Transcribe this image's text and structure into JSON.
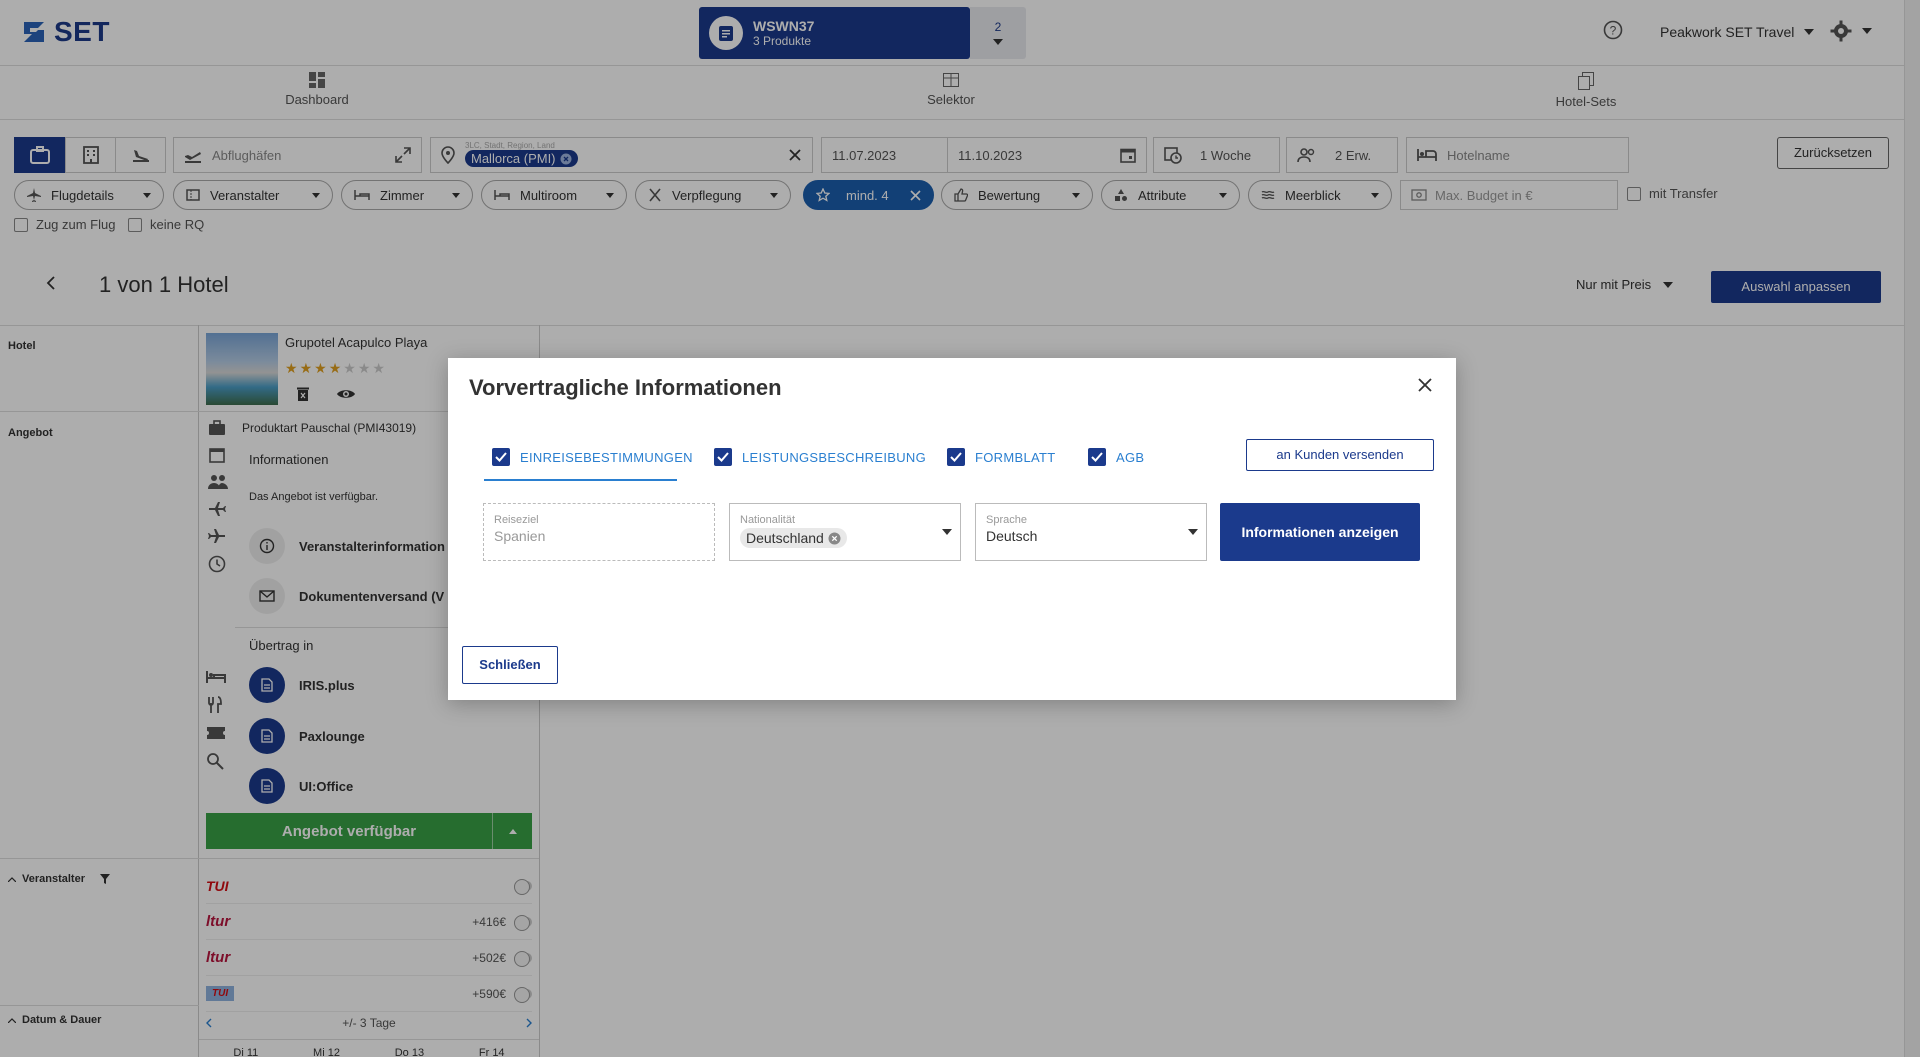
{
  "header": {
    "logo": "SET",
    "cart_code": "WSWN37",
    "cart_sub": "3 Produkte",
    "cart_count": "2",
    "agency": "Peakwork SET Travel"
  },
  "nav": {
    "tabs": [
      {
        "label": "Dashboard",
        "icon": "dashboard-icon"
      },
      {
        "label": "Selektor",
        "icon": "table-icon"
      },
      {
        "label": "Hotel-Sets",
        "icon": "copy-icon"
      }
    ]
  },
  "search": {
    "departure_placeholder": "Abflughäfen",
    "destination_label": "3LC, Stadt, Region, Land",
    "destination_chip": "Mallorca (PMI)",
    "date_from": "11.07.2023",
    "date_to": "11.10.2023",
    "duration": "1 Woche",
    "travelers": "2 Erw.",
    "hotel_placeholder": "Hotelname",
    "reset": "Zurücksetzen"
  },
  "filters": {
    "pills": [
      "Flugdetails",
      "Veranstalter",
      "Zimmer",
      "Multiroom",
      "Verpflegung",
      "mind. 4",
      "Bewertung",
      "Attribute",
      "Meerblick"
    ],
    "budget_placeholder": "Max. Budget in €",
    "transfer": "mit Transfer",
    "train": "Zug zum Flug",
    "no_rq": "keine RQ"
  },
  "results": {
    "title": "1 von 1 Hotel",
    "sort": "Nur mit Preis",
    "adjust": "Auswahl anpassen"
  },
  "left": {
    "hotel_label": "Hotel",
    "offer_label": "Angebot",
    "operator_label": "Veranstalter",
    "date_label": "Datum & Dauer",
    "hotel_name": "Grupotel Acapulco Playa",
    "stars_on": 4,
    "stars_total": 7,
    "product_type": "Produktart Pauschal (PMI43019)",
    "info_title": "Informationen",
    "info_text": "Das Angebot ist verfügbar.",
    "operator_info": "Veranstalterinformation",
    "doc_send": "Dokumentenversand (V",
    "transfer_in": "Übertrag in",
    "systems": [
      "IRIS.plus",
      "Paxlounge",
      "UI:Office"
    ],
    "available_btn": "Angebot verfügbar",
    "operators": [
      {
        "name": "TUI",
        "price": ""
      },
      {
        "name": "ltur",
        "price": "+416€"
      },
      {
        "name": "ltur",
        "price": "+502€"
      },
      {
        "name": "TUI",
        "price": "+590€"
      }
    ],
    "days_range": "+/- 3 Tage",
    "days": [
      "Di 11",
      "Mi 12",
      "Do 13",
      "Fr 14"
    ]
  },
  "modal": {
    "title": "Vorvertragliche Informationen",
    "tabs": [
      "EINREISEBESTIMMUNGEN",
      "LEISTUNGSBESCHREIBUNG",
      "FORMBLATT",
      "AGB"
    ],
    "send": "an Kunden versenden",
    "dest_label": "Reiseziel",
    "dest_value": "Spanien",
    "nat_label": "Nationalität",
    "nat_value": "Deutschland",
    "lang_label": "Sprache",
    "lang_value": "Deutsch",
    "show_btn": "Informationen anzeigen",
    "close_btn": "Schließen"
  },
  "colors": {
    "primary": "#1b3a8c",
    "accent": "#2a7fd0",
    "success": "#38a146"
  }
}
